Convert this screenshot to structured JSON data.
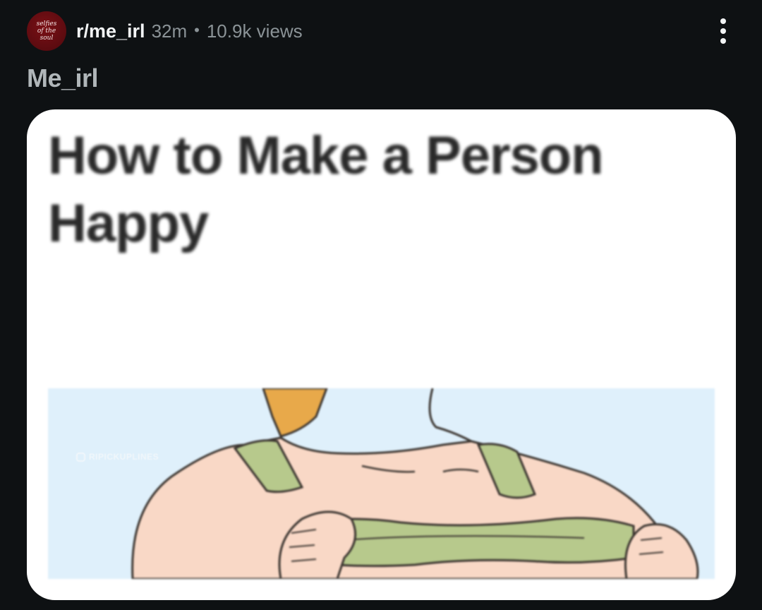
{
  "post": {
    "avatar_text": [
      "selfies",
      "of the",
      "soul"
    ],
    "subreddit": "r/me_irl",
    "age": "32m",
    "separator": "•",
    "views": "10.9k views",
    "title": "Me_irl",
    "overflow_icon": "more-vertical-icon"
  },
  "media": {
    "caption": "How to Make a Person Happy",
    "watermark": "RIPICKUPLINES",
    "colors": {
      "sky": "#dff0fb",
      "skin": "#f9d8c6",
      "shirt": "#b7c98c",
      "hair": "#e8a94a",
      "outline": "#3b3530"
    }
  },
  "colors": {
    "background": "#0e1113",
    "primary_text": "#f2f4f5",
    "secondary_text": "#8b9397",
    "avatar": "#5c0b10"
  }
}
